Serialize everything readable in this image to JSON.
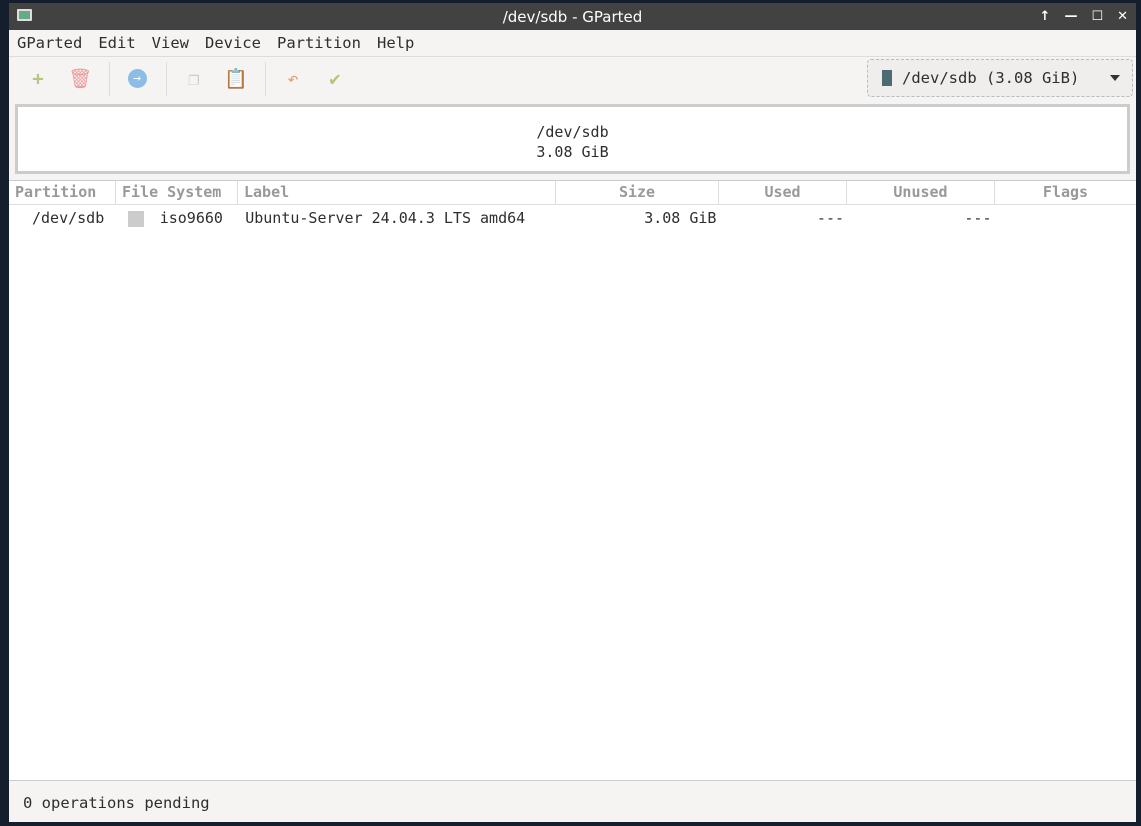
{
  "window": {
    "title": "/dev/sdb - GParted"
  },
  "menu": [
    "GParted",
    "Edit",
    "View",
    "Device",
    "Partition",
    "Help"
  ],
  "toolbar": {
    "device_selector": "/dev/sdb (3.08 GiB)"
  },
  "disk_map": {
    "device": "/dev/sdb",
    "size": "3.08 GiB"
  },
  "table": {
    "headers": [
      "Partition",
      "File System",
      "Label",
      "Size",
      "Used",
      "Unused",
      "Flags"
    ],
    "rows": [
      {
        "partition": "/dev/sdb",
        "fs": "iso9660",
        "fs_color": "#cccccc",
        "label": "Ubuntu-Server 24.04.3 LTS amd64",
        "size": "3.08 GiB",
        "used": "---",
        "unused": "---",
        "flags": ""
      }
    ]
  },
  "status": "0 operations pending"
}
